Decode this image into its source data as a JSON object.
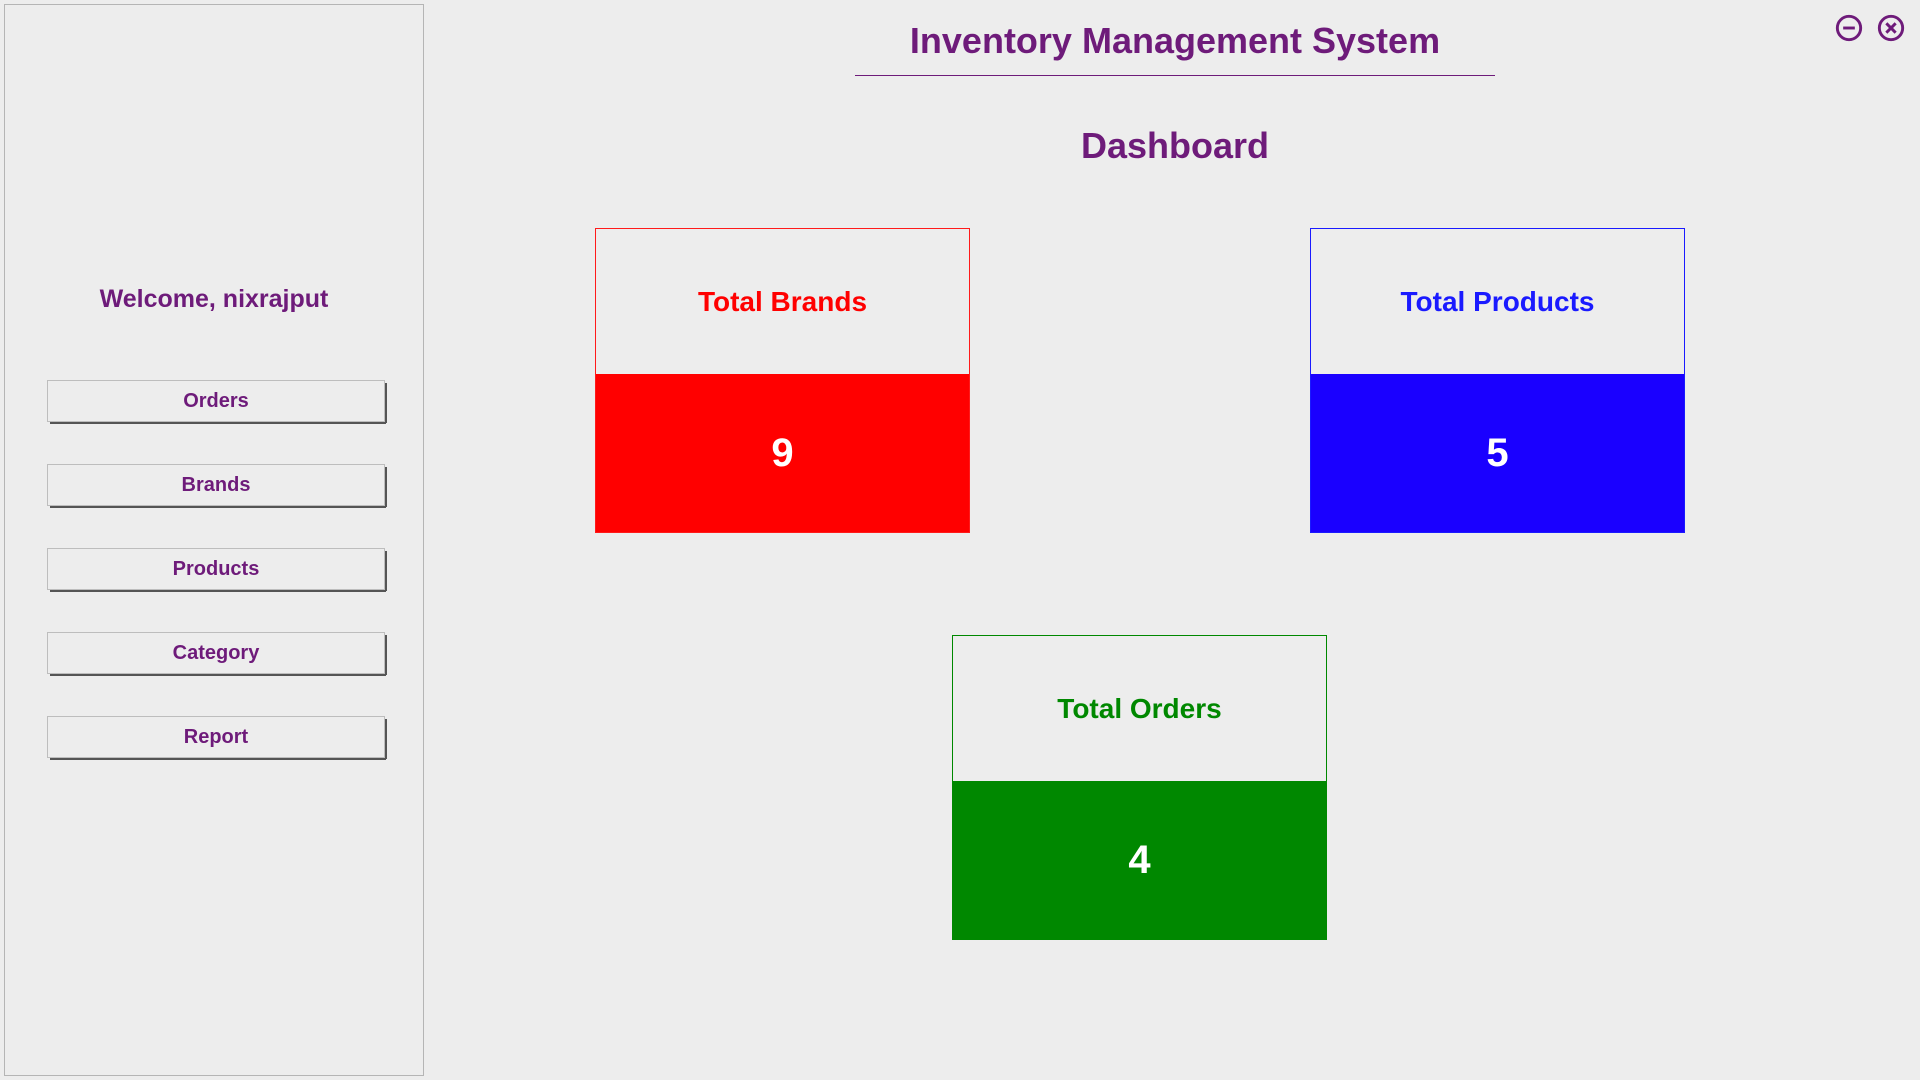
{
  "app": {
    "title": "Inventory Management System",
    "page_title": "Dashboard"
  },
  "sidebar": {
    "welcome": "Welcome, nixrajput",
    "nav": [
      {
        "label": "Orders"
      },
      {
        "label": "Brands"
      },
      {
        "label": "Products"
      },
      {
        "label": "Category"
      },
      {
        "label": "Report"
      }
    ]
  },
  "dashboard": {
    "cards": {
      "brands": {
        "title": "Total Brands",
        "value": "9"
      },
      "products": {
        "title": "Total Products",
        "value": "5"
      },
      "orders": {
        "title": "Total Orders",
        "value": "4"
      }
    }
  },
  "colors": {
    "primary": "#6e1b7a",
    "brands": "#ff0000",
    "products": "#1a00ff",
    "orders": "#008800"
  }
}
